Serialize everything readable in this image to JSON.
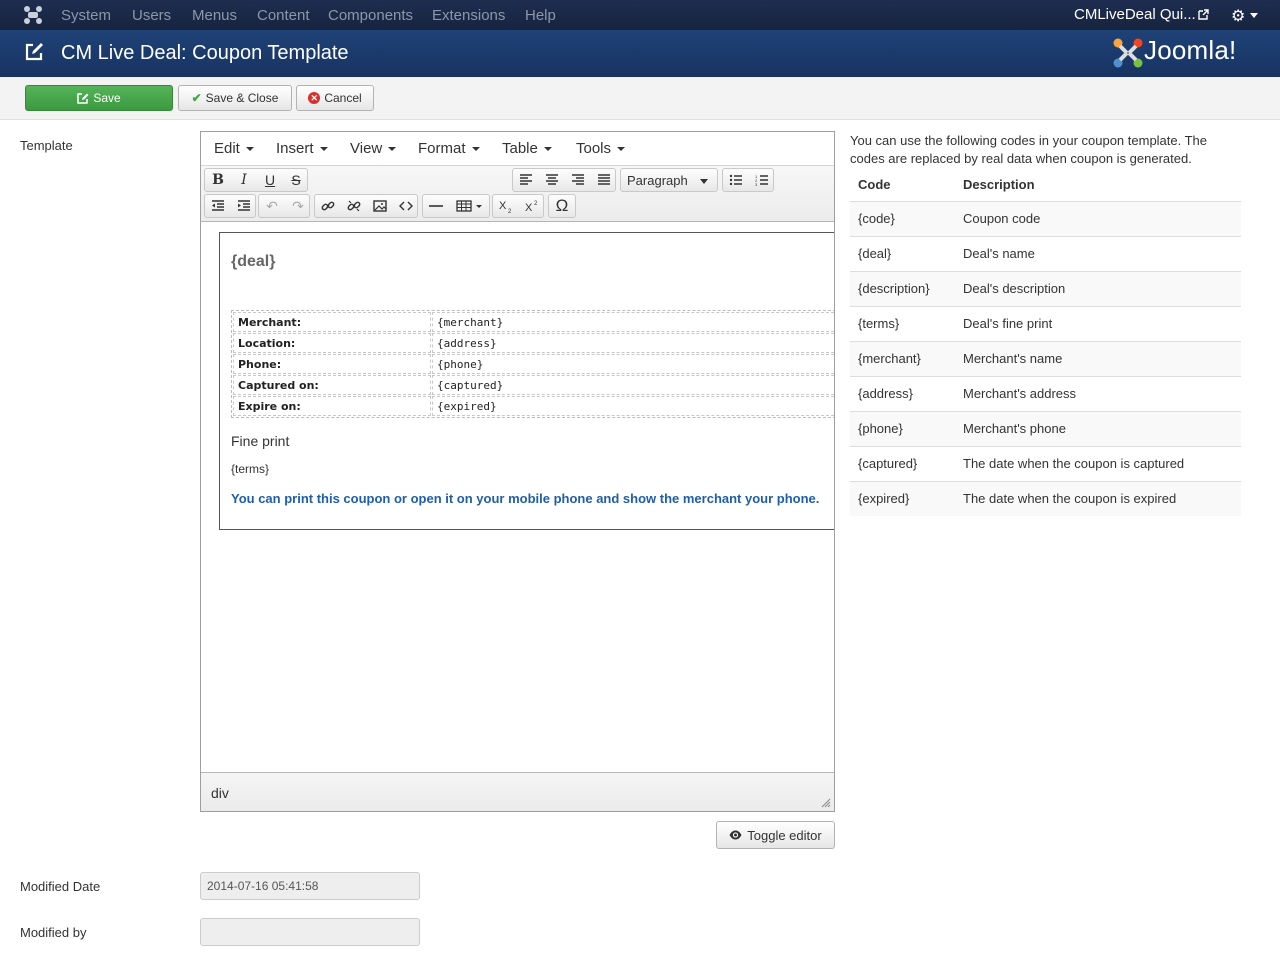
{
  "topnav": {
    "menu": [
      "System",
      "Users",
      "Menus",
      "Content",
      "Components",
      "Extensions",
      "Help"
    ],
    "site_link": "CMLiveDeal Qui..."
  },
  "header": {
    "title": "CM Live Deal: Coupon Template",
    "brand": "Joomla!"
  },
  "toolbar": {
    "save_label": "Save",
    "save_close_label": "Save & Close",
    "cancel_label": "Cancel"
  },
  "form": {
    "template_label": "Template",
    "modified_date_label": "Modified Date",
    "modified_date_value": "2014-07-16 05:41:58",
    "modified_by_label": "Modified by",
    "modified_by_value": ""
  },
  "editor": {
    "menus": [
      "Edit",
      "Insert",
      "View",
      "Format",
      "Table",
      "Tools"
    ],
    "block_format": "Paragraph",
    "status_path": "div",
    "toggle_label": "Toggle editor",
    "content": {
      "deal": "{deal}",
      "rows": [
        {
          "key": "Merchant:",
          "value": "{merchant}"
        },
        {
          "key": "Location:",
          "value": "{address}"
        },
        {
          "key": "Phone:",
          "value": "{phone}"
        },
        {
          "key": "Captured on:",
          "value": "{captured}"
        },
        {
          "key": "Expire on:",
          "value": "{expired}"
        }
      ],
      "fine_print": "Fine print",
      "terms": "{terms}",
      "note": "You can print this coupon or open it on your mobile phone and show the merchant your phone."
    }
  },
  "help": {
    "intro": "You can use the following codes in your coupon template. The codes are replaced by real data when coupon is generated.",
    "headers": [
      "Code",
      "Description"
    ],
    "rows": [
      {
        "code": "{code}",
        "desc": "Coupon code"
      },
      {
        "code": "{deal}",
        "desc": "Deal's name"
      },
      {
        "code": "{description}",
        "desc": "Deal's description"
      },
      {
        "code": "{terms}",
        "desc": "Deal's fine print"
      },
      {
        "code": "{merchant}",
        "desc": "Merchant's name"
      },
      {
        "code": "{address}",
        "desc": "Merchant's address"
      },
      {
        "code": "{phone}",
        "desc": "Merchant's phone"
      },
      {
        "code": "{captured}",
        "desc": "The date when the coupon is captured"
      },
      {
        "code": "{expired}",
        "desc": "The date when the coupon is expired"
      }
    ]
  },
  "colors": {
    "topnav_bg": "#1b2a4a",
    "header_bg": "#1a3867",
    "save_green": "#46a546",
    "cancel_red": "#d9302c",
    "note_blue": "#1f5ea8"
  }
}
